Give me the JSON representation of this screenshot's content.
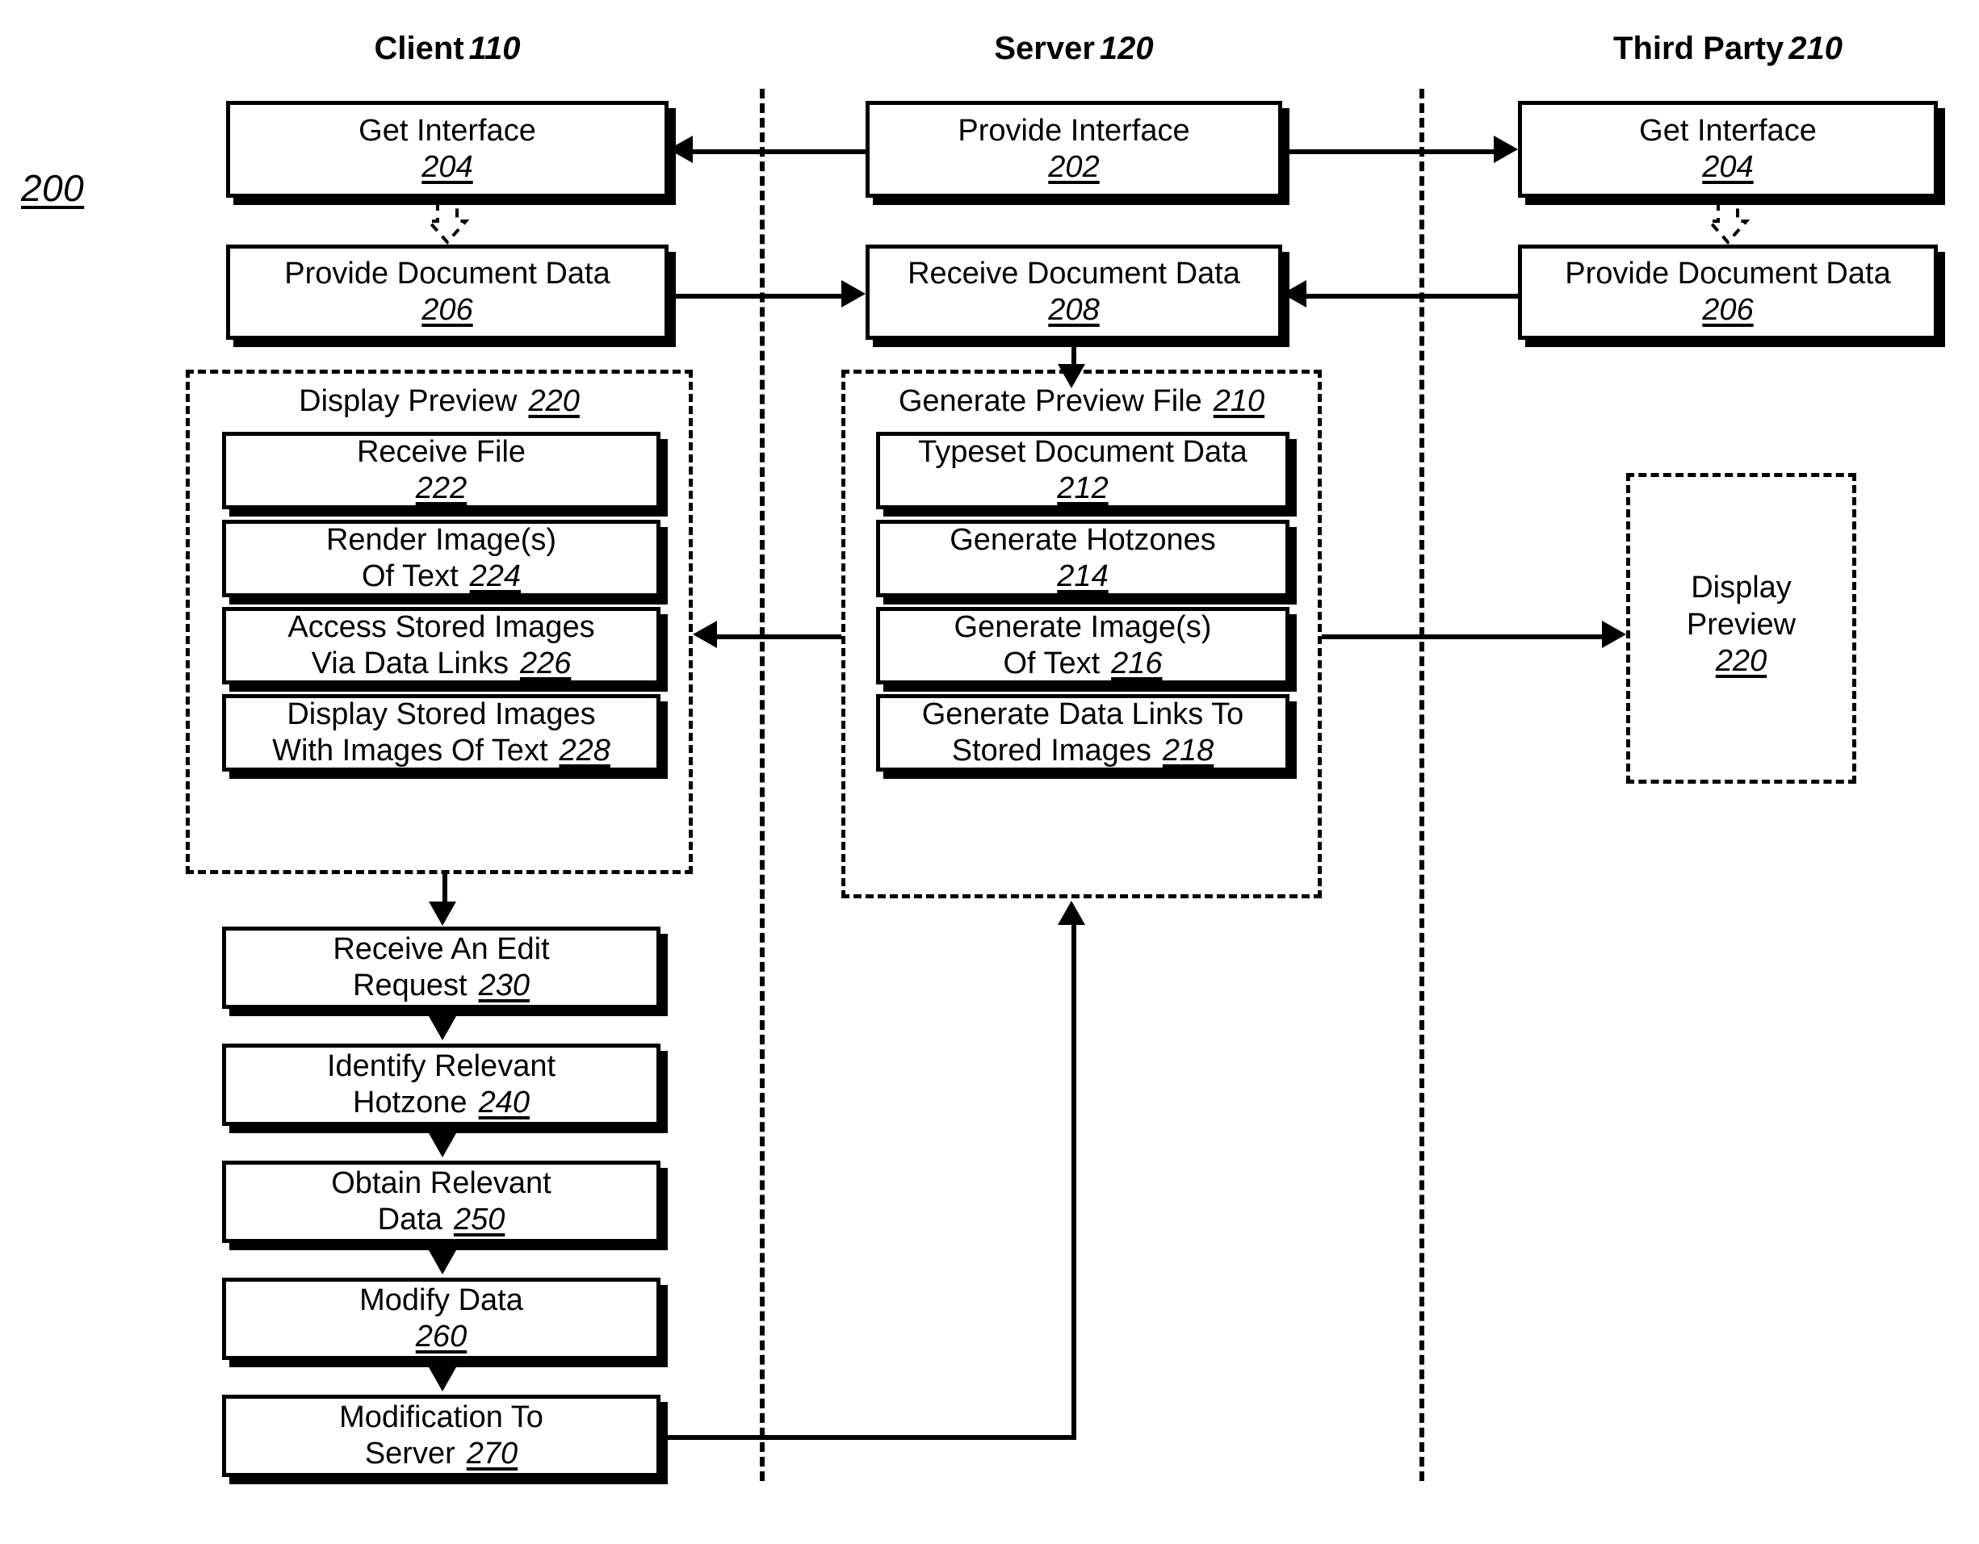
{
  "figure": {
    "number": "200"
  },
  "lanes": [
    {
      "id": "client",
      "title": "Client",
      "ref": "110"
    },
    {
      "id": "server",
      "title": "Server",
      "ref": "120"
    },
    {
      "id": "third_party",
      "title": "Third Party",
      "ref": "210"
    }
  ],
  "boxes": {
    "get_interface_client": {
      "line1": "Get Interface",
      "line2": "",
      "ref": "204"
    },
    "provide_interface": {
      "line1": "Provide Interface",
      "line2": "",
      "ref": "202"
    },
    "get_interface_third": {
      "line1": "Get Interface",
      "line2": "",
      "ref": "204"
    },
    "provide_doc_client": {
      "line1": "Provide Document Data",
      "line2": "",
      "ref": "206"
    },
    "receive_doc_server": {
      "line1": "Receive Document Data",
      "line2": "",
      "ref": "208"
    },
    "provide_doc_third": {
      "line1": "Provide Document Data",
      "line2": "",
      "ref": "206"
    },
    "receive_file": {
      "line1": "Receive File",
      "line2": "",
      "ref": "222"
    },
    "render_images": {
      "line1": "Render Image(s)",
      "line2": "Of Text",
      "ref": "224"
    },
    "access_stored_images": {
      "line1": "Access Stored Images",
      "line2": "Via Data Links",
      "ref": "226"
    },
    "display_stored_images": {
      "line1": "Display Stored Images",
      "line2": "With Images Of Text",
      "ref": "228"
    },
    "typeset_doc_data": {
      "line1": "Typeset Document Data",
      "line2": "",
      "ref": "212"
    },
    "generate_hotzones": {
      "line1": "Generate Hotzones",
      "line2": "",
      "ref": "214"
    },
    "generate_images_text": {
      "line1": "Generate Image(s)",
      "line2": "Of Text",
      "ref": "216"
    },
    "generate_data_links": {
      "line1": "Generate Data Links To",
      "line2": "Stored Images",
      "ref": "218"
    },
    "receive_edit_request": {
      "line1": "Receive An Edit",
      "line2": "Request",
      "ref": "230"
    },
    "identify_hotzone": {
      "line1": "Identify Relevant",
      "line2": "Hotzone",
      "ref": "240"
    },
    "obtain_relevant_data": {
      "line1": "Obtain Relevant",
      "line2": "Data",
      "ref": "250"
    },
    "modify_data": {
      "line1": "Modify Data",
      "line2": "",
      "ref": "260"
    },
    "modification_to_server": {
      "line1": "Modification To",
      "line2": "Server",
      "ref": "270"
    }
  },
  "groups": {
    "display_preview_client": {
      "title": "Display Preview",
      "ref": "220"
    },
    "generate_preview_file": {
      "title": "Generate Preview File",
      "ref": "210"
    },
    "display_preview_third": {
      "line1": "Display",
      "line2": "Preview",
      "ref": "220"
    }
  },
  "colors": {
    "stroke": "#000000",
    "background": "#ffffff"
  }
}
